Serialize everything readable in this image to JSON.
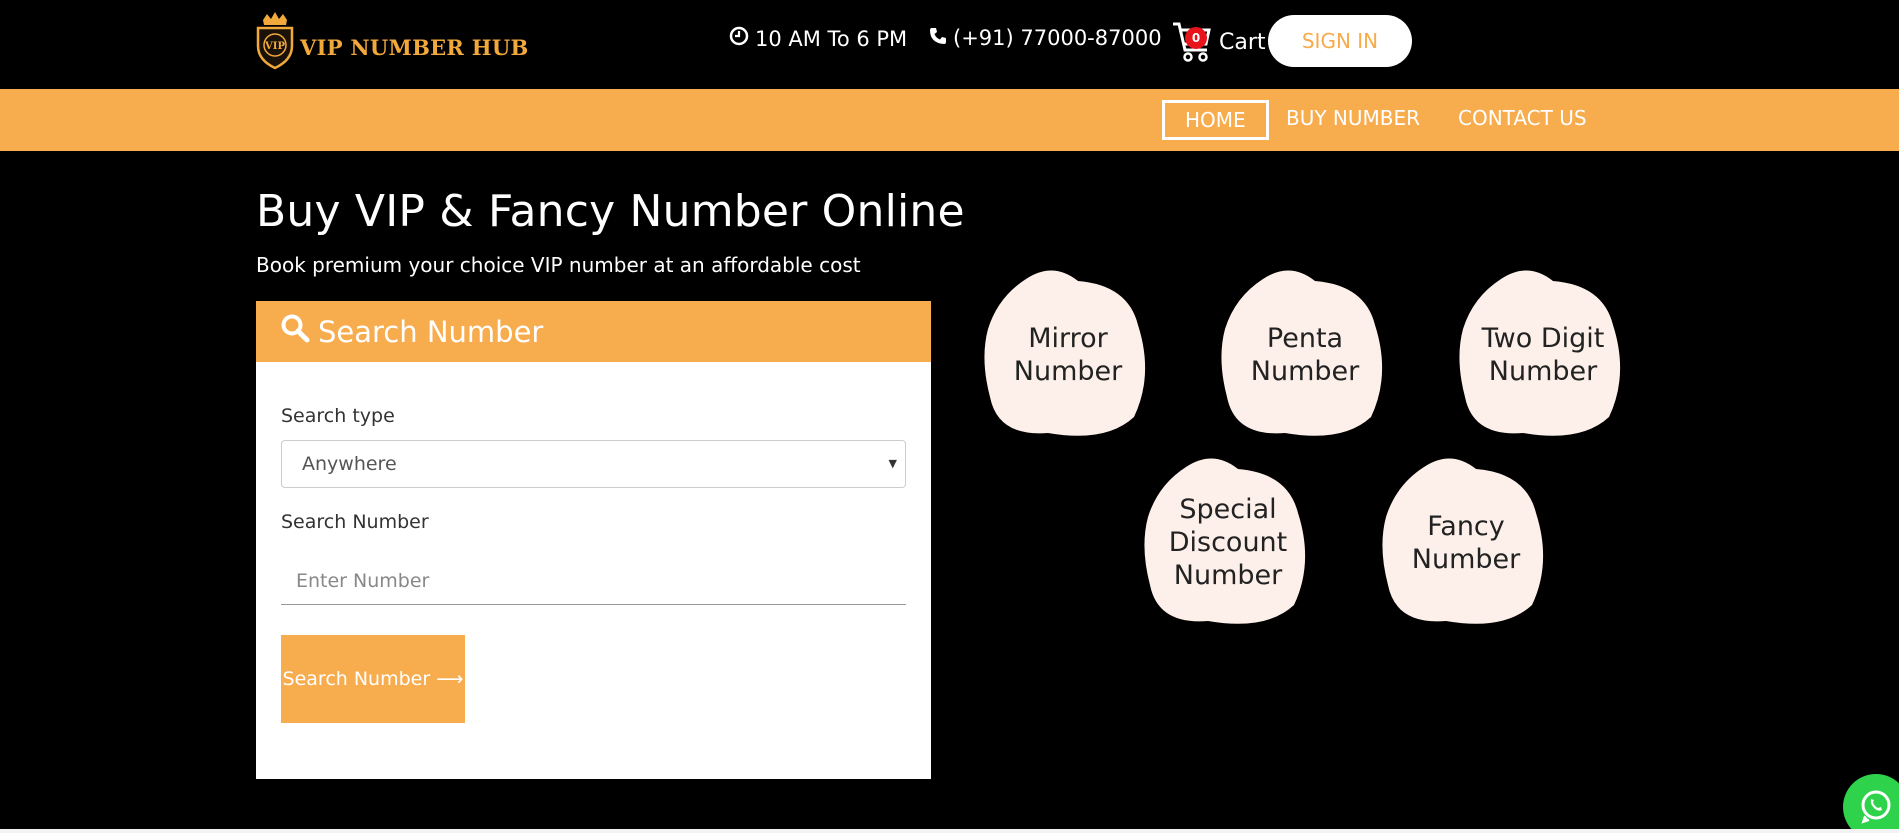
{
  "header": {
    "brand": "VIP NUMBER HUB",
    "badge_text": "VIP",
    "hours": "10 AM To 6 PM",
    "phone": "(+91) 77000-87000",
    "cart_label": "Cart",
    "cart_count": "0",
    "signin_label": "SIGN IN"
  },
  "nav": {
    "items": [
      {
        "label": "HOME",
        "active": true
      },
      {
        "label": "BUY NUMBER",
        "active": false
      },
      {
        "label": "CONTACT US",
        "active": false
      }
    ]
  },
  "hero": {
    "title": "Buy VIP & Fancy Number Online",
    "subtitle": "Book premium your choice VIP number at an affordable cost"
  },
  "search_card": {
    "heading": "Search Number",
    "type_label": "Search type",
    "type_value": "Anywhere",
    "number_label": "Search Number",
    "number_placeholder": "Enter Number",
    "button_label": "Search Number ⟶"
  },
  "categories": [
    {
      "line1": "Mirror",
      "line2": "Number",
      "line3": ""
    },
    {
      "line1": "Penta",
      "line2": "Number",
      "line3": ""
    },
    {
      "line1": "Two Digit",
      "line2": "Number",
      "line3": ""
    },
    {
      "line1": "Special",
      "line2": "Discount",
      "line3": "Number"
    },
    {
      "line1": "Fancy",
      "line2": "Number",
      "line3": ""
    }
  ],
  "colors": {
    "accent": "#f7ac4d",
    "brand_gold": "#f2a93b",
    "blob_fill": "#fdf0ea",
    "cart_badge": "#e8131b",
    "whatsapp": "#2ed24b"
  },
  "icons": {
    "clock": "clock-icon",
    "phone": "phone-icon",
    "cart": "cart-icon",
    "search": "search-icon",
    "whatsapp": "whatsapp-icon"
  }
}
